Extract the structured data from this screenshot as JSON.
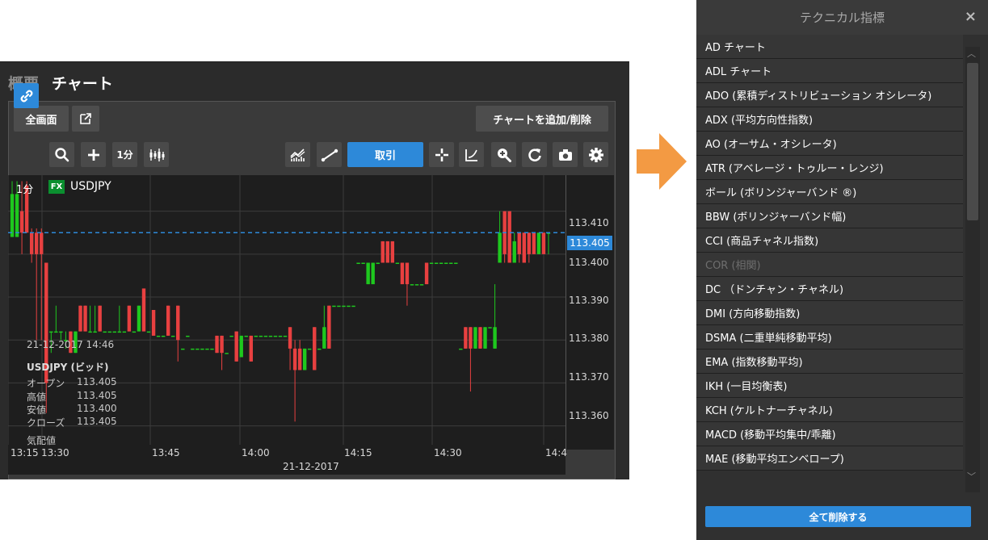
{
  "chart_window": {
    "tabs": [
      {
        "label": "概要"
      },
      {
        "label": "チャート"
      }
    ],
    "fullscreen_label": "全画面",
    "add_remove_label": "チャートを追加/削除",
    "interval_label": "1分",
    "trade_label": "取引",
    "chart_interval": "1分",
    "fx_badge": "FX",
    "symbol": "USDJPY",
    "current_price": "113.405",
    "hover": {
      "datetime": "21-12-2017 14:46",
      "title": "USDJPY (ビッド)",
      "rows": [
        {
          "label": "オープン",
          "value": "113.405"
        },
        {
          "label": "高値",
          "value": "113.405"
        },
        {
          "label": "安値",
          "value": "113.400"
        },
        {
          "label": "クローズ",
          "value": "113.405"
        }
      ],
      "footer": "気配値"
    },
    "date_label": "21-12-2017",
    "colors": {
      "up": "#1ec81e",
      "down": "#e84040",
      "accent": "#2d89d9"
    }
  },
  "chart_data": {
    "type": "candlestick",
    "x_ticks": [
      "13:15",
      "13:30",
      "13:45",
      "14:00",
      "14:15",
      "14:30",
      "14:4"
    ],
    "y_ticks": [
      "113.410",
      "113.400",
      "113.390",
      "113.380",
      "113.370",
      "113.360"
    ],
    "ylim": [
      113.3556,
      113.4184
    ],
    "grid": true,
    "current_line": 113.405,
    "candles": [
      {
        "t": 0,
        "o": 113.404,
        "c": 113.414,
        "h": 113.417,
        "l": 113.404
      },
      {
        "t": 1,
        "o": 113.404,
        "c": 113.414,
        "h": 113.417,
        "l": 113.404
      },
      {
        "t": 2,
        "o": 113.41,
        "c": 113.405,
        "h": 113.417,
        "l": 113.4
      },
      {
        "t": 3,
        "o": 113.416,
        "c": 113.405,
        "h": 113.417,
        "l": 113.405
      },
      {
        "t": 4,
        "o": 113.405,
        "c": 113.4,
        "h": 113.406,
        "l": 113.398
      },
      {
        "t": 5,
        "o": 113.405,
        "c": 113.4,
        "h": 113.406,
        "l": 113.38
      },
      {
        "t": 6,
        "o": 113.405,
        "c": 113.4,
        "h": 113.406,
        "l": 113.38
      },
      {
        "t": 7,
        "o": 113.398,
        "c": 113.37,
        "h": 113.398,
        "l": 113.363
      },
      {
        "t": 8,
        "o": 113.382,
        "c": 113.382,
        "h": 113.382,
        "l": 113.377
      },
      {
        "t": 9,
        "o": 113.382,
        "c": 113.382,
        "h": 113.388,
        "l": 113.382
      },
      {
        "t": 10,
        "o": 113.382,
        "c": 113.382,
        "h": 113.382,
        "l": 113.38
      },
      {
        "t": 11,
        "o": 113.38,
        "c": 113.38,
        "h": 113.382,
        "l": 113.378
      },
      {
        "t": 12,
        "o": 113.382,
        "c": 113.377,
        "h": 113.382,
        "l": 113.377
      },
      {
        "t": 13,
        "o": 113.377,
        "c": 113.382,
        "h": 113.382,
        "l": 113.377
      },
      {
        "t": 14,
        "o": 113.388,
        "c": 113.382,
        "h": 113.388,
        "l": 113.382
      },
      {
        "t": 15,
        "o": 113.388,
        "c": 113.382,
        "h": 113.388,
        "l": 113.382
      },
      {
        "t": 16,
        "o": 113.382,
        "c": 113.382,
        "h": 113.388,
        "l": 113.382
      },
      {
        "t": 17,
        "o": 113.382,
        "c": 113.382,
        "h": 113.388,
        "l": 113.382
      },
      {
        "t": 18,
        "o": 113.388,
        "c": 113.382,
        "h": 113.388,
        "l": 113.382
      },
      {
        "t": 19,
        "o": 113.382,
        "c": 113.382,
        "h": 113.382,
        "l": 113.382
      },
      {
        "t": 20,
        "o": 113.382,
        "c": 113.382,
        "h": 113.382,
        "l": 113.382
      },
      {
        "t": 21,
        "o": 113.382,
        "c": 113.382,
        "h": 113.382,
        "l": 113.382
      },
      {
        "t": 22,
        "o": 113.382,
        "c": 113.382,
        "h": 113.388,
        "l": 113.382
      },
      {
        "t": 23,
        "o": 113.382,
        "c": 113.382,
        "h": 113.382,
        "l": 113.382
      },
      {
        "t": 24,
        "o": 113.388,
        "c": 113.382,
        "h": 113.388,
        "l": 113.382
      },
      {
        "t": 25,
        "o": 113.382,
        "c": 113.382,
        "h": 113.382,
        "l": 113.382
      },
      {
        "t": 26,
        "o": 113.382,
        "c": 113.388,
        "h": 113.388,
        "l": 113.382
      },
      {
        "t": 27,
        "o": 113.392,
        "c": 113.382,
        "h": 113.392,
        "l": 113.382
      },
      {
        "t": 28,
        "o": 113.382,
        "c": 113.382,
        "h": 113.382,
        "l": 113.382
      },
      {
        "t": 29,
        "o": 113.387,
        "c": 113.381,
        "h": 113.387,
        "l": 113.381
      },
      {
        "t": 30,
        "o": 113.381,
        "c": 113.381,
        "h": 113.381,
        "l": 113.381
      },
      {
        "t": 31,
        "o": 113.381,
        "c": 113.381,
        "h": 113.381,
        "l": 113.381
      },
      {
        "t": 32,
        "o": 113.388,
        "c": 113.381,
        "h": 113.388,
        "l": 113.381
      },
      {
        "t": 33,
        "o": 113.381,
        "c": 113.381,
        "h": 113.381,
        "l": 113.381
      },
      {
        "t": 34,
        "o": 113.388,
        "c": 113.38,
        "h": 113.388,
        "l": 113.375
      },
      {
        "t": 35,
        "o": 113.378,
        "c": 113.378,
        "h": 113.378,
        "l": 113.378
      },
      {
        "t": 36,
        "o": 113.381,
        "c": 113.381,
        "h": 113.381,
        "l": 113.381
      },
      {
        "t": 37,
        "o": 113.378,
        "c": 113.378,
        "h": 113.378,
        "l": 113.378
      },
      {
        "t": 38,
        "o": 113.378,
        "c": 113.378,
        "h": 113.378,
        "l": 113.378
      },
      {
        "t": 39,
        "o": 113.378,
        "c": 113.378,
        "h": 113.378,
        "l": 113.378
      },
      {
        "t": 40,
        "o": 113.378,
        "c": 113.378,
        "h": 113.378,
        "l": 113.378
      },
      {
        "t": 41,
        "o": 113.378,
        "c": 113.378,
        "h": 113.378,
        "l": 113.378
      },
      {
        "t": 42,
        "o": 113.381,
        "c": 113.377,
        "h": 113.381,
        "l": 113.377
      },
      {
        "t": 43,
        "o": 113.381,
        "c": 113.377,
        "h": 113.381,
        "l": 113.373
      },
      {
        "t": 44,
        "o": 113.377,
        "c": 113.377,
        "h": 113.377,
        "l": 113.377
      },
      {
        "t": 45,
        "o": 113.381,
        "c": 113.381,
        "h": 113.381,
        "l": 113.381
      },
      {
        "t": 46,
        "o": 113.382,
        "c": 113.375,
        "h": 113.382,
        "l": 113.375
      },
      {
        "t": 47,
        "o": 113.376,
        "c": 113.381,
        "h": 113.381,
        "l": 113.376
      },
      {
        "t": 48,
        "o": 113.381,
        "c": 113.381,
        "h": 113.381,
        "l": 113.381
      },
      {
        "t": 49,
        "o": 113.381,
        "c": 113.375,
        "h": 113.381,
        "l": 113.375
      },
      {
        "t": 50,
        "o": 113.381,
        "c": 113.381,
        "h": 113.381,
        "l": 113.381
      },
      {
        "t": 51,
        "o": 113.381,
        "c": 113.381,
        "h": 113.381,
        "l": 113.381
      },
      {
        "t": 52,
        "o": 113.381,
        "c": 113.381,
        "h": 113.381,
        "l": 113.381
      },
      {
        "t": 53,
        "o": 113.381,
        "c": 113.381,
        "h": 113.381,
        "l": 113.381
      },
      {
        "t": 54,
        "o": 113.381,
        "c": 113.381,
        "h": 113.381,
        "l": 113.381
      },
      {
        "t": 55,
        "o": 113.381,
        "c": 113.381,
        "h": 113.381,
        "l": 113.381
      },
      {
        "t": 56,
        "o": 113.381,
        "c": 113.381,
        "h": 113.381,
        "l": 113.381
      },
      {
        "t": 57,
        "o": 113.383,
        "c": 113.378,
        "h": 113.383,
        "l": 113.373
      },
      {
        "t": 58,
        "o": 113.378,
        "c": 113.373,
        "h": 113.38,
        "l": 113.361
      },
      {
        "t": 59,
        "o": 113.378,
        "c": 113.373,
        "h": 113.38,
        "l": 113.373
      },
      {
        "t": 60,
        "o": 113.373,
        "c": 113.378,
        "h": 113.378,
        "l": 113.373
      },
      {
        "t": 61,
        "o": 113.378,
        "c": 113.378,
        "h": 113.378,
        "l": 113.378
      },
      {
        "t": 62,
        "o": 113.383,
        "c": 113.373,
        "h": 113.383,
        "l": 113.373
      },
      {
        "t": 63,
        "o": 113.378,
        "c": 113.378,
        "h": 113.378,
        "l": 113.378
      },
      {
        "t": 64,
        "o": 113.378,
        "c": 113.383,
        "h": 113.388,
        "l": 113.378
      },
      {
        "t": 65,
        "o": 113.388,
        "c": 113.378,
        "h": 113.388,
        "l": 113.378
      },
      {
        "t": 66,
        "o": 113.388,
        "c": 113.388,
        "h": 113.388,
        "l": 113.388
      },
      {
        "t": 67,
        "o": 113.388,
        "c": 113.388,
        "h": 113.388,
        "l": 113.388
      },
      {
        "t": 68,
        "o": 113.388,
        "c": 113.388,
        "h": 113.388,
        "l": 113.388
      },
      {
        "t": 69,
        "o": 113.388,
        "c": 113.388,
        "h": 113.388,
        "l": 113.388
      },
      {
        "t": 70,
        "o": 113.388,
        "c": 113.388,
        "h": 113.388,
        "l": 113.388
      },
      {
        "t": 71,
        "o": 113.398,
        "c": 113.398,
        "h": 113.398,
        "l": 113.398
      },
      {
        "t": 72,
        "o": 113.398,
        "c": 113.398,
        "h": 113.398,
        "l": 113.398
      },
      {
        "t": 73,
        "o": 113.393,
        "c": 113.398,
        "h": 113.398,
        "l": 113.393
      },
      {
        "t": 74,
        "o": 113.393,
        "c": 113.398,
        "h": 113.398,
        "l": 113.393
      },
      {
        "t": 75,
        "o": 113.398,
        "c": 113.398,
        "h": 113.398,
        "l": 113.398
      },
      {
        "t": 76,
        "o": 113.403,
        "c": 113.398,
        "h": 113.403,
        "l": 113.398
      },
      {
        "t": 77,
        "o": 113.403,
        "c": 113.398,
        "h": 113.403,
        "l": 113.398
      },
      {
        "t": 78,
        "o": 113.403,
        "c": 113.398,
        "h": 113.403,
        "l": 113.398
      },
      {
        "t": 79,
        "o": 113.398,
        "c": 113.398,
        "h": 113.398,
        "l": 113.398
      },
      {
        "t": 80,
        "o": 113.398,
        "c": 113.393,
        "h": 113.398,
        "l": 113.393
      },
      {
        "t": 81,
        "o": 113.398,
        "c": 113.393,
        "h": 113.398,
        "l": 113.388
      },
      {
        "t": 82,
        "o": 113.393,
        "c": 113.393,
        "h": 113.393,
        "l": 113.393
      },
      {
        "t": 83,
        "o": 113.393,
        "c": 113.393,
        "h": 113.393,
        "l": 113.393
      },
      {
        "t": 84,
        "o": 113.393,
        "c": 113.393,
        "h": 113.393,
        "l": 113.393
      },
      {
        "t": 85,
        "o": 113.398,
        "c": 113.393,
        "h": 113.398,
        "l": 113.393
      },
      {
        "t": 86,
        "o": 113.398,
        "c": 113.398,
        "h": 113.398,
        "l": 113.398
      },
      {
        "t": 87,
        "o": 113.398,
        "c": 113.398,
        "h": 113.398,
        "l": 113.398
      },
      {
        "t": 88,
        "o": 113.398,
        "c": 113.398,
        "h": 113.398,
        "l": 113.398
      },
      {
        "t": 89,
        "o": 113.398,
        "c": 113.398,
        "h": 113.398,
        "l": 113.398
      },
      {
        "t": 90,
        "o": 113.398,
        "c": 113.398,
        "h": 113.398,
        "l": 113.398
      },
      {
        "t": 91,
        "o": 113.398,
        "c": 113.398,
        "h": 113.398,
        "l": 113.398
      },
      {
        "t": 92,
        "o": 113.378,
        "c": 113.378,
        "h": 113.378,
        "l": 113.378
      },
      {
        "t": 93,
        "o": 113.383,
        "c": 113.378,
        "h": 113.383,
        "l": 113.378
      },
      {
        "t": 94,
        "o": 113.383,
        "c": 113.378,
        "h": 113.383,
        "l": 113.368
      },
      {
        "t": 95,
        "o": 113.378,
        "c": 113.383,
        "h": 113.383,
        "l": 113.378
      },
      {
        "t": 96,
        "o": 113.383,
        "c": 113.378,
        "h": 113.383,
        "l": 113.378
      },
      {
        "t": 97,
        "o": 113.378,
        "c": 113.383,
        "h": 113.383,
        "l": 113.378
      },
      {
        "t": 98,
        "o": 113.383,
        "c": 113.383,
        "h": 113.383,
        "l": 113.383
      },
      {
        "t": 99,
        "o": 113.378,
        "c": 113.383,
        "h": 113.393,
        "l": 113.378
      },
      {
        "t": 100,
        "o": 113.398,
        "c": 113.405,
        "h": 113.41,
        "l": 113.398
      },
      {
        "t": 101,
        "o": 113.41,
        "c": 113.4,
        "h": 113.41,
        "l": 113.398
      },
      {
        "t": 102,
        "o": 113.41,
        "c": 113.398,
        "h": 113.41,
        "l": 113.398
      },
      {
        "t": 103,
        "o": 113.398,
        "c": 113.403,
        "h": 113.405,
        "l": 113.398
      },
      {
        "t": 104,
        "o": 113.405,
        "c": 113.4,
        "h": 113.405,
        "l": 113.398
      },
      {
        "t": 105,
        "o": 113.405,
        "c": 113.398,
        "h": 113.405,
        "l": 113.398
      },
      {
        "t": 106,
        "o": 113.405,
        "c": 113.4,
        "h": 113.405,
        "l": 113.398
      },
      {
        "t": 107,
        "o": 113.405,
        "c": 113.4,
        "h": 113.405,
        "l": 113.4
      },
      {
        "t": 108,
        "o": 113.4,
        "c": 113.405,
        "h": 113.405,
        "l": 113.4
      },
      {
        "t": 109,
        "o": 113.405,
        "c": 113.4,
        "h": 113.405,
        "l": 113.4
      },
      {
        "t": 110,
        "o": 113.405,
        "c": 113.405,
        "h": 113.405,
        "l": 113.4
      }
    ]
  },
  "technical_panel": {
    "title": "テクニカル指標",
    "close_label": "×",
    "items": [
      {
        "label": "AD チャート",
        "disabled": false
      },
      {
        "label": "ADL チャート",
        "disabled": false
      },
      {
        "label": "ADO (累積ディストリビューション オシレータ)",
        "disabled": false
      },
      {
        "label": "ADX (平均方向性指数)",
        "disabled": false
      },
      {
        "label": "AO (オーサム・オシレータ)",
        "disabled": false
      },
      {
        "label": "ATR (アベレージ・トゥルー・レンジ)",
        "disabled": false
      },
      {
        "label": "ボール (ボリンジャーバンド ®)",
        "disabled": false
      },
      {
        "label": "BBW (ボリンジャーバンド幅)",
        "disabled": false
      },
      {
        "label": "CCI (商品チャネル指数)",
        "disabled": false
      },
      {
        "label": "COR (相関)",
        "disabled": true
      },
      {
        "label": "DC （ドンチャン・チャネル)",
        "disabled": false
      },
      {
        "label": "DMI (方向移動指数)",
        "disabled": false
      },
      {
        "label": "DSMA (二重単純移動平均)",
        "disabled": false
      },
      {
        "label": "EMA (指数移動平均)",
        "disabled": false
      },
      {
        "label": "IKH (一目均衡表)",
        "disabled": false
      },
      {
        "label": "KCH (ケルトナーチャネル)",
        "disabled": false
      },
      {
        "label": "MACD (移動平均集中/乖離)",
        "disabled": false
      },
      {
        "label": "MAE (移動平均エンベロープ)",
        "disabled": false
      }
    ],
    "clear_all_label": "全て削除する"
  }
}
